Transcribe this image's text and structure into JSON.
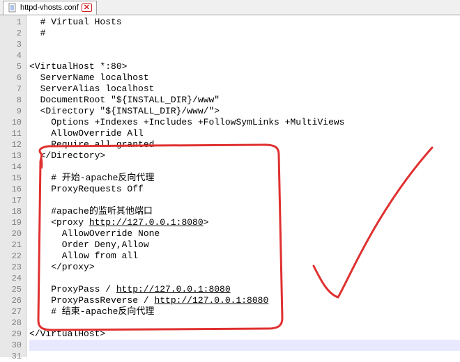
{
  "tab": {
    "filename": "httpd-vhosts.conf"
  },
  "lines": [
    {
      "num": 1,
      "text": "  # Virtual Hosts"
    },
    {
      "num": 2,
      "text": "  #"
    },
    {
      "num": 3,
      "text": ""
    },
    {
      "num": 4,
      "text": ""
    },
    {
      "num": 5,
      "text": "<VirtualHost *:80>"
    },
    {
      "num": 6,
      "text": "  ServerName localhost"
    },
    {
      "num": 7,
      "text": "  ServerAlias localhost"
    },
    {
      "num": 8,
      "text": "  DocumentRoot \"${INSTALL_DIR}/www\""
    },
    {
      "num": 9,
      "text": "  <Directory \"${INSTALL_DIR}/www/\">"
    },
    {
      "num": 10,
      "text": "    Options +Indexes +Includes +FollowSymLinks +MultiViews"
    },
    {
      "num": 11,
      "text": "    AllowOverride All"
    },
    {
      "num": 12,
      "text": "    Require all granted"
    },
    {
      "num": 13,
      "text": "  </Directory>"
    },
    {
      "num": 14,
      "text": ""
    },
    {
      "num": 15,
      "text": "    # 开始-apache反向代理"
    },
    {
      "num": 16,
      "text": "    ProxyRequests Off"
    },
    {
      "num": 17,
      "text": ""
    },
    {
      "num": 18,
      "text": "    #apache的监听其他端口"
    },
    {
      "num": 19,
      "parts": [
        {
          "t": "    <proxy "
        },
        {
          "t": "http://127.0.0.1:8080",
          "u": true
        },
        {
          "t": ">"
        }
      ]
    },
    {
      "num": 20,
      "text": "      AllowOverride None"
    },
    {
      "num": 21,
      "text": "      Order Deny,Allow"
    },
    {
      "num": 22,
      "text": "      Allow from all"
    },
    {
      "num": 23,
      "text": "    </proxy>"
    },
    {
      "num": 24,
      "text": ""
    },
    {
      "num": 25,
      "parts": [
        {
          "t": "    ProxyPass / "
        },
        {
          "t": "http://127.0.0.1:8080",
          "u": true
        }
      ]
    },
    {
      "num": 26,
      "parts": [
        {
          "t": "    ProxyPassReverse / "
        },
        {
          "t": "http://127.0.0.1:8080",
          "u": true
        }
      ]
    },
    {
      "num": 27,
      "text": "    # 结束-apache反向代理"
    },
    {
      "num": 28,
      "text": ""
    },
    {
      "num": 29,
      "text": "</VirtualHost>"
    },
    {
      "num": 30,
      "text": "",
      "cursor": true
    },
    {
      "num": 31,
      "text": ""
    }
  ],
  "annotation": {
    "color": "#e03030"
  }
}
